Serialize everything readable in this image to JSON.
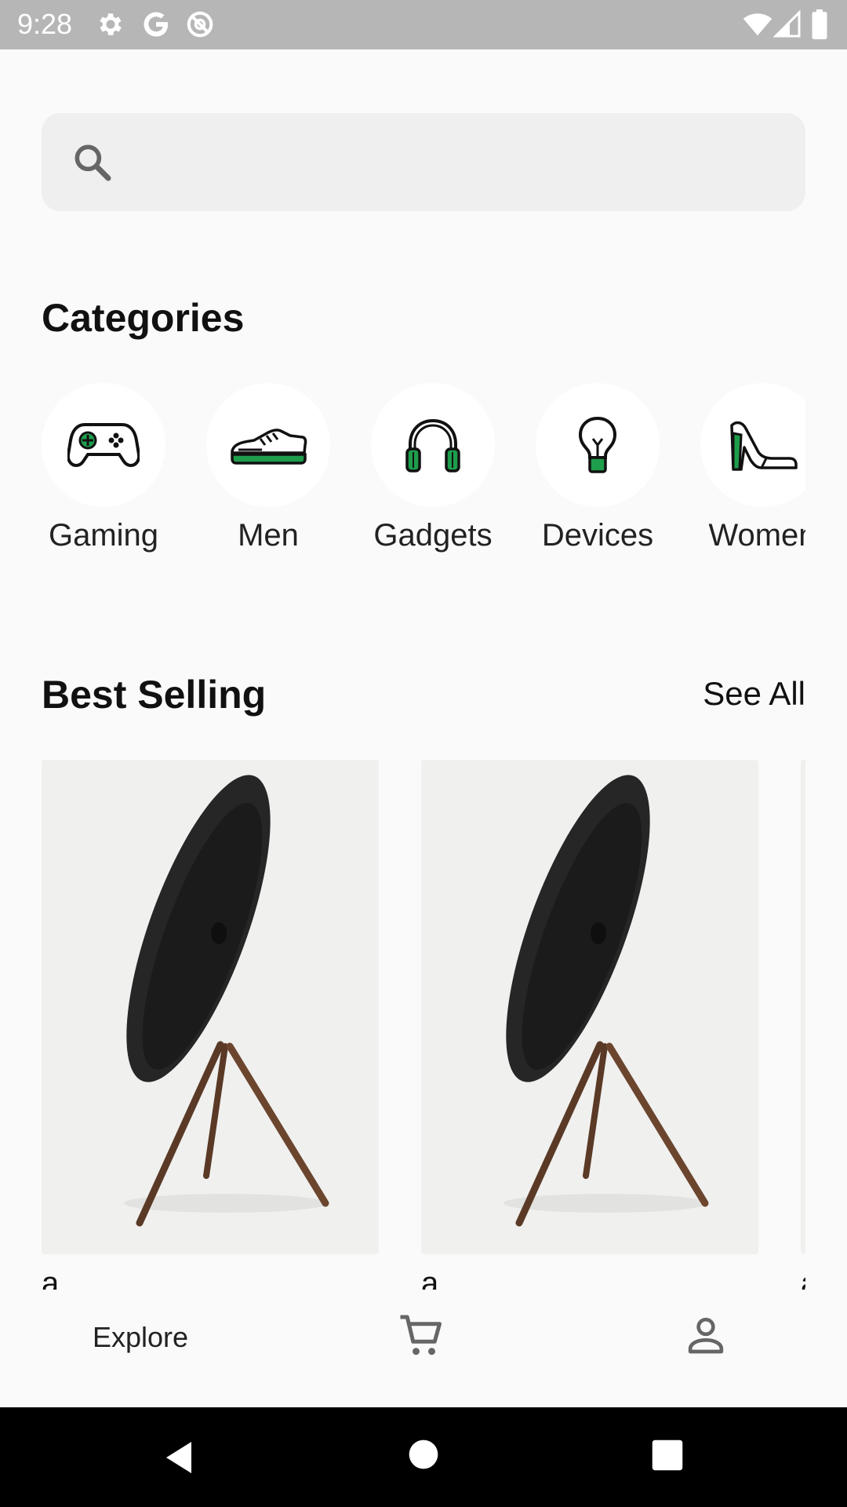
{
  "status_bar": {
    "time": "9:28",
    "icons": [
      "settings-icon",
      "google-icon",
      "data-saver-icon",
      "wifi-icon",
      "signal-icon",
      "battery-icon"
    ]
  },
  "search": {
    "placeholder": "",
    "value": ""
  },
  "categories": {
    "title": "Categories",
    "items": [
      {
        "label": "Gaming",
        "icon": "gamepad-icon"
      },
      {
        "label": "Men",
        "icon": "sneaker-icon"
      },
      {
        "label": "Gadgets",
        "icon": "headphones-icon"
      },
      {
        "label": "Devices",
        "icon": "lightbulb-icon"
      },
      {
        "label": "Women",
        "icon": "high-heel-icon"
      }
    ]
  },
  "best_selling": {
    "title": "Best Selling",
    "see_all_label": "See All",
    "products": [
      {
        "name": "a",
        "image": "speaker-stand-image"
      },
      {
        "name": "a",
        "image": "speaker-stand-image"
      },
      {
        "name": "a",
        "image": "speaker-stand-image"
      }
    ]
  },
  "bottom_nav": {
    "explore_label": "Explore",
    "items": [
      "explore",
      "cart-icon",
      "account-icon"
    ]
  },
  "colors": {
    "accent_green": "#1e9e4c",
    "background": "#fafafa",
    "search_bg": "#efefef",
    "status_bar": "#b6b6b6"
  }
}
